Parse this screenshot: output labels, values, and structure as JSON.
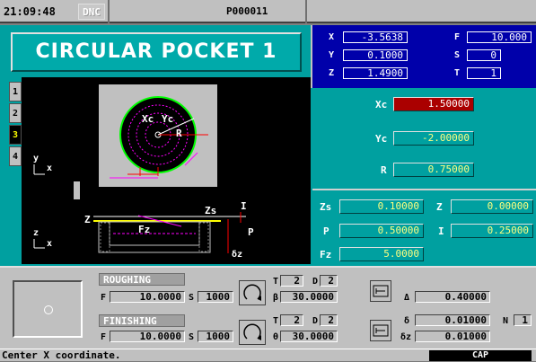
{
  "topbar": {
    "clock": "21:09:48",
    "dnc": "DNC",
    "program": "P000011"
  },
  "title": "CIRCULAR POCKET 1",
  "tabs": [
    "1",
    "2",
    "3",
    "4"
  ],
  "active_tab": "3",
  "drawing": {
    "top_labels": {
      "xc": "Xc",
      "yc": "Yc",
      "r": "R",
      "y": "y",
      "x": "x"
    },
    "bottom_labels": {
      "zs": "Zs",
      "i": "I",
      "z": "Z",
      "fz": "Fz",
      "p": "P",
      "dz": "δz",
      "z2": "z",
      "x2": "x"
    }
  },
  "coords": {
    "X": "-3.5638",
    "Y": "0.1000",
    "Z": "1.4900",
    "F": "10.000",
    "S": "0",
    "T": "1"
  },
  "params": {
    "xc_label": "Xc",
    "xc": "1.50000",
    "yc_label": "Yc",
    "yc": "-2.00000",
    "r_label": "R",
    "r": "0.75000",
    "zs_label": "Zs",
    "zs": "0.10000",
    "z_label": "Z",
    "z": "0.00000",
    "p_label": "P",
    "p": "0.50000",
    "i_label": "I",
    "i": "0.25000",
    "fz_label": "Fz",
    "fz": "5.0000"
  },
  "roughing": {
    "header": "ROUGHING",
    "f_label": "F",
    "f": "10.0000",
    "s_label": "S",
    "s": "1000",
    "t_label": "T",
    "t": "2",
    "d_label": "D",
    "d": "2",
    "beta_label": "β",
    "beta": "30.0000",
    "delta_label": "Δ",
    "delta": "0.40000"
  },
  "finishing": {
    "header": "FINISHING",
    "f_label": "F",
    "f": "10.0000",
    "s_label": "S",
    "s": "1000",
    "t_label": "T",
    "t": "2",
    "d_label": "D",
    "d": "2",
    "theta_label": "θ",
    "theta": "30.0000",
    "delta_label": "δ",
    "delta": "0.01000",
    "dz_label": "δz",
    "dz": "0.01000",
    "n_label": "N",
    "n": "1"
  },
  "status": {
    "message": "Center X coordinate.",
    "mode": "CAP"
  },
  "colors": {
    "panel": "#00a0a0",
    "coords_bg": "#0000aa",
    "selected": "#aa0000",
    "drawing_bg": "#000000"
  }
}
